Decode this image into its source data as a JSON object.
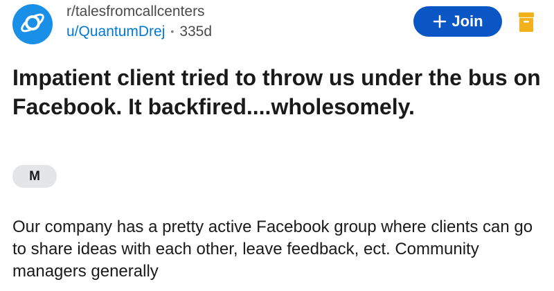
{
  "header": {
    "subreddit": "r/talesfromcallcenters",
    "username": "u/QuantumDrej",
    "separator": "•",
    "age": "335d",
    "join_label": "Join",
    "avatar_icon": "planet-icon",
    "plus_icon": "plus-icon",
    "save_icon": "archive-icon"
  },
  "post": {
    "title": "Impatient client tried to throw us under the bus on Facebook. It backfired....wholesomely.",
    "flair": "M",
    "body": "Our company has a pretty active Facebook group where clients can go to share ideas with each other, leave feedback, ect. Community managers generally"
  },
  "colors": {
    "accent": "#0a56c5",
    "link": "#0079d3",
    "avatar": "#1a8fe8",
    "archive": "#f2b21c"
  }
}
